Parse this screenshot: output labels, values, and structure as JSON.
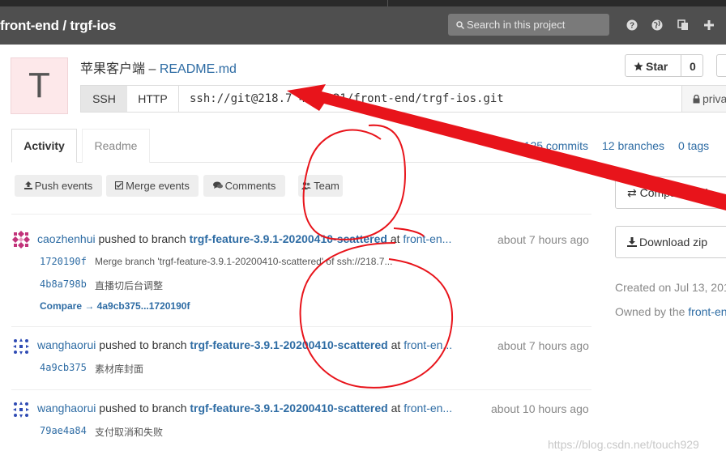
{
  "header": {
    "project_path": "front-end / trgf-ios",
    "search_placeholder": "Search in this project",
    "icons": [
      "help-icon",
      "globe-icon",
      "copy-icon",
      "plus-icon"
    ]
  },
  "project": {
    "avatar_letter": "T",
    "title_prefix": "苹果客户端 –",
    "readme_link": "README.md",
    "star_label": "Star",
    "star_count": "0",
    "clone": {
      "ssh_label": "SSH",
      "http_label": "HTTP",
      "url": "ssh://git@218.7    40:9021/front-end/trgf-ios.git",
      "visibility": "priva"
    }
  },
  "tabs": [
    {
      "label": "Activity",
      "active": true
    },
    {
      "label": "Readme",
      "active": false
    }
  ],
  "stats": {
    "commits": "1,125 commits",
    "branches": "12 branches",
    "tags": "0 tags"
  },
  "filters": [
    {
      "label": "Push events",
      "icon": "upload-icon"
    },
    {
      "label": "Merge events",
      "icon": "check-square-icon"
    },
    {
      "label": "Comments",
      "icon": "comments-icon"
    },
    {
      "label": "Team",
      "icon": "users-icon"
    }
  ],
  "events": [
    {
      "author": "caozhenhui",
      "action": "pushed to branch",
      "branch": "trgf-feature-3.9.1-20200410-scattered",
      "at": "at",
      "project": "front-en...",
      "time": "about 7 hours ago",
      "commits": [
        {
          "sha": "1720190f",
          "message": "Merge branch 'trgf-feature-3.9.1-20200410-scattered' of ssh://218.7..."
        },
        {
          "sha": "4b8a798b",
          "message": "直播切后台调整"
        }
      ],
      "compare": "Compare → 4a9cb375...1720190f"
    },
    {
      "author": "wanghaorui",
      "action": "pushed to branch",
      "branch": "trgf-feature-3.9.1-20200410-scattered",
      "at": "at",
      "project": "front-en...",
      "time": "about 7 hours ago",
      "commits": [
        {
          "sha": "4a9cb375",
          "message": "素材库封面"
        }
      ]
    },
    {
      "author": "wanghaorui",
      "action": "pushed to branch",
      "branch": "trgf-feature-3.9.1-20200410-scattered",
      "at": "at",
      "project": "front-en...",
      "time": "about 10 hours ago",
      "commits": [
        {
          "sha": "79ae4a84",
          "message": "支付取消和失败"
        }
      ]
    }
  ],
  "sidebar": {
    "compare_label": "Compare code",
    "download_label": "Download zip",
    "created_prefix": "Created on Jul 13, 201",
    "owned_prefix": "Owned by the",
    "owned_link": "front-end"
  },
  "annotation": {
    "stroke_color": "#e8141b"
  },
  "watermark": "https://blog.csdn.net/touch929"
}
